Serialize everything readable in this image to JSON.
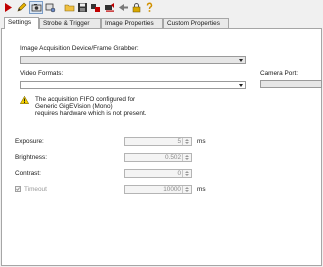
{
  "toolbar": {
    "icons": [
      "play-icon",
      "edit-icon",
      "camera-icon",
      "device-settings-icon",
      "open-folder-icon",
      "save-icon",
      "image-tools-icon",
      "snapshot-icon",
      "arrow-icon",
      "lock-icon",
      "help-icon"
    ]
  },
  "tabs": [
    {
      "label": "Settings"
    },
    {
      "label": "Strobe & Trigger"
    },
    {
      "label": "Image Properties"
    },
    {
      "label": "Custom Properties"
    }
  ],
  "settings": {
    "device_label": "Image Acquisition Device/Frame Grabber:",
    "device_value": "",
    "video_format_label": "Video Formats:",
    "video_format_value": "",
    "camera_port_label": "Camera Port:",
    "warning_line1": "The acquisition FIFO configured for",
    "warning_line2": "Generic GigEVision (Mono)",
    "warning_line3": "requires hardware which is not present.",
    "exposure": {
      "label": "Exposure:",
      "value": "5",
      "unit": "ms"
    },
    "brightness": {
      "label": "Brightness:",
      "value": "0.502"
    },
    "contrast": {
      "label": "Contrast:",
      "value": "0"
    },
    "timeout": {
      "label": "Timeout",
      "value": "10000",
      "unit": "ms",
      "checked": true
    }
  },
  "colors": {
    "warning": "#f5d000",
    "panel_bg": "#ffffff",
    "window_bg": "#f0f0f0"
  }
}
